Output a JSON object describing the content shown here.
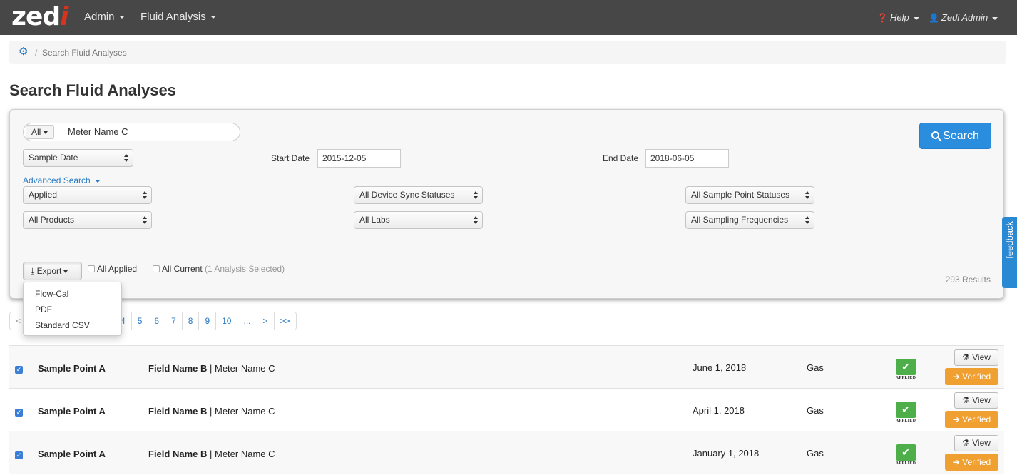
{
  "navbar": {
    "logo_main": "zed",
    "logo_accent": "i",
    "menu": [
      {
        "label": "Admin"
      },
      {
        "label": "Fluid Analysis"
      }
    ],
    "help_label": "Help",
    "user_label": "Zedi Admin"
  },
  "breadcrumb": {
    "separator": "/",
    "current": "Search Fluid Analyses"
  },
  "page": {
    "title": "Search Fluid Analyses"
  },
  "search": {
    "scope_label": "All",
    "query_value": "Meter Name C",
    "submit_label": "Search",
    "date_type": "Sample Date",
    "start_date_label": "Start Date",
    "start_date_value": "2015-12-05",
    "end_date_label": "End Date",
    "end_date_value": "2018-06-05",
    "advanced_label": "Advanced Search",
    "filters": {
      "applied": "Applied",
      "device_sync": "All Device Sync Statuses",
      "sample_point_status": "All Sample Point Statuses",
      "products": "All Products",
      "labs": "All Labs",
      "sampling_frequency": "All Sampling Frequencies"
    }
  },
  "export": {
    "label": "Export",
    "all_applied_label": "All Applied",
    "all_current_label": "All Current",
    "selected_note": "(1 Analysis Selected)",
    "menu": [
      "Flow-Cal",
      "PDF",
      "Standard CSV"
    ]
  },
  "results_count": "293 Results",
  "feedback_label": "feedback",
  "pagination": [
    "<",
    "4",
    "5",
    "6",
    "7",
    "8",
    "9",
    "10",
    "...",
    ">",
    ">>"
  ],
  "rows": [
    {
      "sample_point": "Sample Point A",
      "field": "Field Name B",
      "sep": "|",
      "meter": "Meter Name C",
      "date": "June 1, 2018",
      "product": "Gas",
      "status": "APPLIED",
      "view": "View",
      "verified": "Verified"
    },
    {
      "sample_point": "Sample Point A",
      "field": "Field Name B",
      "sep": "|",
      "meter": "Meter Name C",
      "date": "April 1, 2018",
      "product": "Gas",
      "status": "APPLIED",
      "view": "View",
      "verified": "Verified"
    },
    {
      "sample_point": "Sample Point A",
      "field": "Field Name B",
      "sep": "|",
      "meter": "Meter Name C",
      "date": "January 1, 2018",
      "product": "Gas",
      "status": "APPLIED",
      "view": "View",
      "verified": "Verified"
    }
  ]
}
